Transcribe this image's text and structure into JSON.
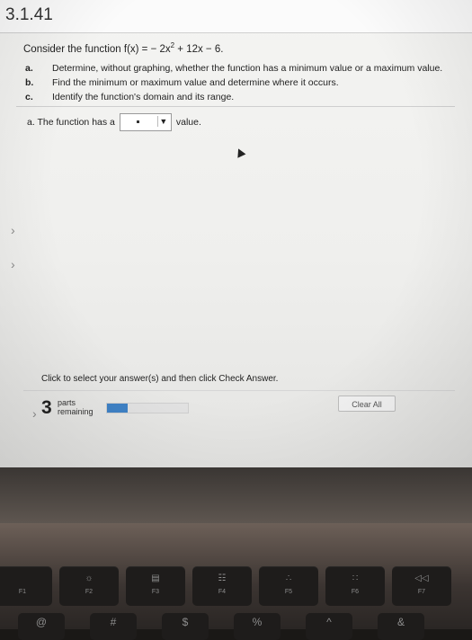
{
  "problem": {
    "number": "3.1.41",
    "prompt_prefix": "Consider the function f(x) = − 2x",
    "prompt_exponent": "2",
    "prompt_suffix": " + 12x − 6.",
    "parts": [
      {
        "letter": "a.",
        "text": "Determine, without graphing, whether the function has a minimum value or a maximum value."
      },
      {
        "letter": "b.",
        "text": "Find the minimum or maximum value and determine where it occurs."
      },
      {
        "letter": "c.",
        "text": "Identify the function's domain and its range."
      }
    ]
  },
  "answer": {
    "prefix": "a. The function has a",
    "dropdown_value": "",
    "suffix": "value."
  },
  "footer": {
    "instruction": "Click to select your answer(s) and then click Check Answer.",
    "parts_count": "3",
    "parts_label_line1": "parts",
    "parts_label_line2": "remaining",
    "progress_fraction": 0.25,
    "clear_all_label": "Clear All"
  },
  "colors": {
    "progress_fill": "#3f82c6"
  },
  "keyboard": {
    "fkeys": [
      {
        "label": "F1",
        "icon": ""
      },
      {
        "label": "F2",
        "icon": "☼"
      },
      {
        "label": "F3",
        "icon": "▤"
      },
      {
        "label": "F4",
        "icon": "☷"
      },
      {
        "label": "F5",
        "icon": "∴"
      },
      {
        "label": "F6",
        "icon": "∷"
      },
      {
        "label": "F7",
        "icon": "◁◁"
      }
    ],
    "bottom": [
      "@",
      "#",
      "$",
      "%",
      "^",
      "&"
    ]
  }
}
